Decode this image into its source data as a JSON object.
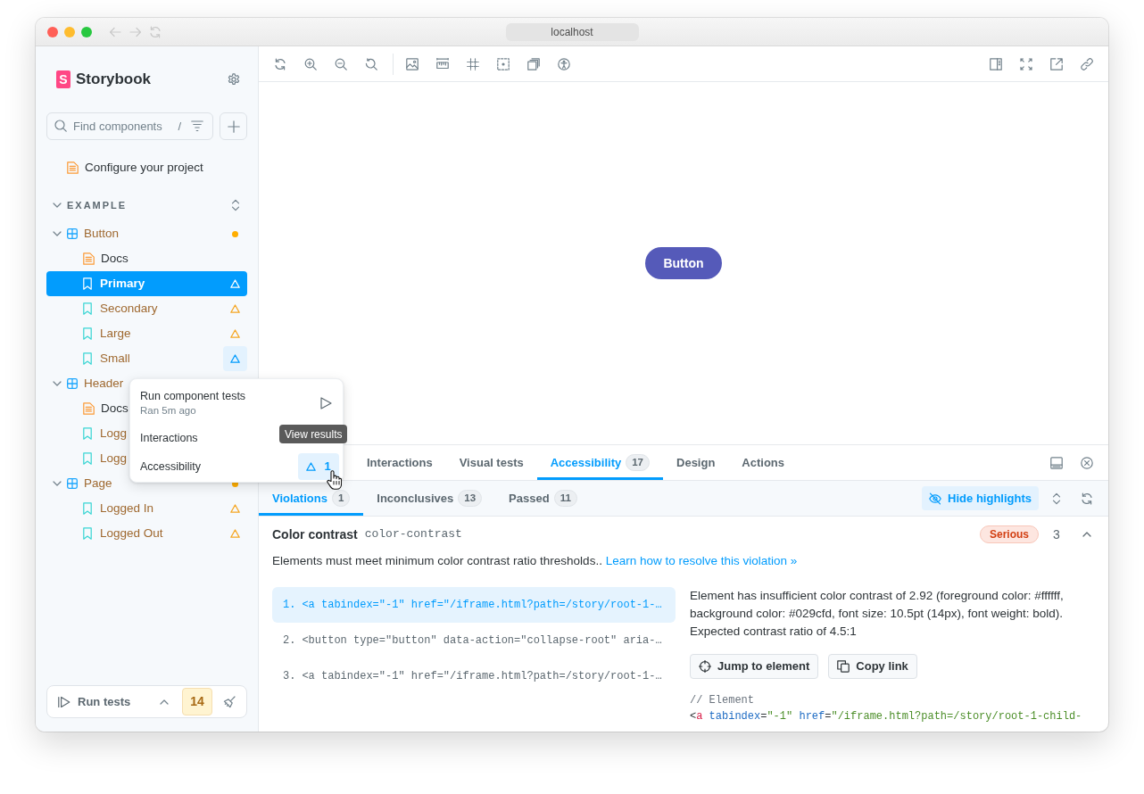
{
  "browser": {
    "url": "localhost"
  },
  "sidebar": {
    "brand": {
      "mark": "S",
      "name": "Storybook"
    },
    "search": {
      "placeholder": "Find components",
      "shortcut": "/"
    },
    "tree": [
      {
        "kind": "doc",
        "label": "Configure your project",
        "selected": false,
        "flagged": false
      },
      {
        "kind": "group",
        "label": "EXAMPLE",
        "selected": false,
        "expanded": true,
        "children": [
          {
            "kind": "component",
            "label": "Button",
            "selected": false,
            "expanded": true,
            "flagged": true,
            "dot": true,
            "children": [
              {
                "kind": "doc",
                "label": "Docs",
                "selected": false,
                "flagged": false,
                "warning": false,
                "menu_open": false
              },
              {
                "kind": "story",
                "label": "Primary",
                "selected": true,
                "flagged": true,
                "warning": true,
                "menu_open": false
              },
              {
                "kind": "story",
                "label": "Secondary",
                "selected": false,
                "flagged": true,
                "warning": true,
                "menu_open": false
              },
              {
                "kind": "story",
                "label": "Large",
                "selected": false,
                "flagged": true,
                "warning": true,
                "menu_open": false
              },
              {
                "kind": "story",
                "label": "Small",
                "selected": false,
                "flagged": true,
                "warning": true,
                "menu_open": true
              }
            ]
          },
          {
            "kind": "component",
            "label": "Header",
            "selected": false,
            "expanded": true,
            "flagged": true,
            "dot": false,
            "children": [
              {
                "kind": "doc",
                "label": "Docs",
                "selected": false,
                "flagged": false
              },
              {
                "kind": "story",
                "label": "Logg",
                "selected": false,
                "flagged": true
              },
              {
                "kind": "story",
                "label": "Logg",
                "selected": false,
                "flagged": true
              }
            ]
          },
          {
            "kind": "component",
            "label": "Page",
            "selected": false,
            "expanded": true,
            "flagged": true,
            "dot": true,
            "children": [
              {
                "kind": "story",
                "label": "Logged In",
                "selected": false,
                "flagged": true,
                "warning": true
              },
              {
                "kind": "story",
                "label": "Logged Out",
                "selected": false,
                "flagged": true,
                "warning": true
              }
            ]
          }
        ]
      }
    ],
    "run_tests": {
      "label": "Run tests",
      "count": "14"
    }
  },
  "test_menu": {
    "items": [
      {
        "kind": "run",
        "label": "Run component tests",
        "subtitle": "Ran 5m ago"
      },
      {
        "kind": "plain",
        "label": "Interactions"
      },
      {
        "kind": "result",
        "label": "Accessibility",
        "count": "1"
      }
    ],
    "tooltip": "View results"
  },
  "preview": {
    "button": "Button"
  },
  "addon_panel": {
    "tabs": [
      {
        "label": "Interactions",
        "selected": false
      },
      {
        "label": "Visual tests",
        "selected": false
      },
      {
        "label": "Accessibility",
        "count": "17",
        "selected": true
      },
      {
        "label": "Design",
        "selected": false
      },
      {
        "label": "Actions",
        "selected": false
      }
    ],
    "subtabs": [
      {
        "label": "Violations",
        "count": "1",
        "selected": true
      },
      {
        "label": "Inconclusives",
        "count": "13",
        "selected": false
      },
      {
        "label": "Passed",
        "count": "11",
        "selected": false
      }
    ],
    "highlight_toggle": "Hide highlights",
    "violation": {
      "title": "Color contrast",
      "rule": "color-contrast",
      "impact": "Serious",
      "count": "3",
      "expanded": true,
      "description": "Elements must meet minimum color contrast ratio thresholds..",
      "link": "Learn how to resolve this violation »",
      "elements": [
        {
          "number": "1.",
          "code": "<a tabindex=\"-1\" href=\"/iframe.html?path=/story/root-1-…",
          "selected": true
        },
        {
          "number": "2.",
          "code": "<button type=\"button\" data-action=\"collapse-root\" aria-…",
          "selected": false
        },
        {
          "number": "3.",
          "code": "<a tabindex=\"-1\" href=\"/iframe.html?path=/story/root-1-…",
          "selected": false
        }
      ],
      "message": "Element has insufficient color contrast of 2.92 (foreground color: #ffffff, background color: #029cfd, font size: 10.5pt (14px), font weight: bold). Expected contrast ratio of 4.5:1",
      "actions": [
        {
          "kind": "jump",
          "label": "Jump to element"
        },
        {
          "kind": "copy",
          "label": "Copy link"
        }
      ],
      "code": [
        {
          "tokens": [
            {
              "kind": "comment",
              "text": "// Element"
            }
          ]
        },
        {
          "tokens": [
            {
              "kind": "punct",
              "text": "<"
            },
            {
              "kind": "tag",
              "text": "a"
            },
            {
              "kind": "attr",
              "text": " tabindex"
            },
            {
              "kind": "punct",
              "text": "="
            },
            {
              "kind": "string",
              "text": "\"-1\""
            },
            {
              "kind": "attr",
              "text": " href"
            },
            {
              "kind": "punct",
              "text": "="
            },
            {
              "kind": "string",
              "text": "\"/iframe.html?path=/story/root-1-child-"
            }
          ]
        }
      ]
    }
  }
}
